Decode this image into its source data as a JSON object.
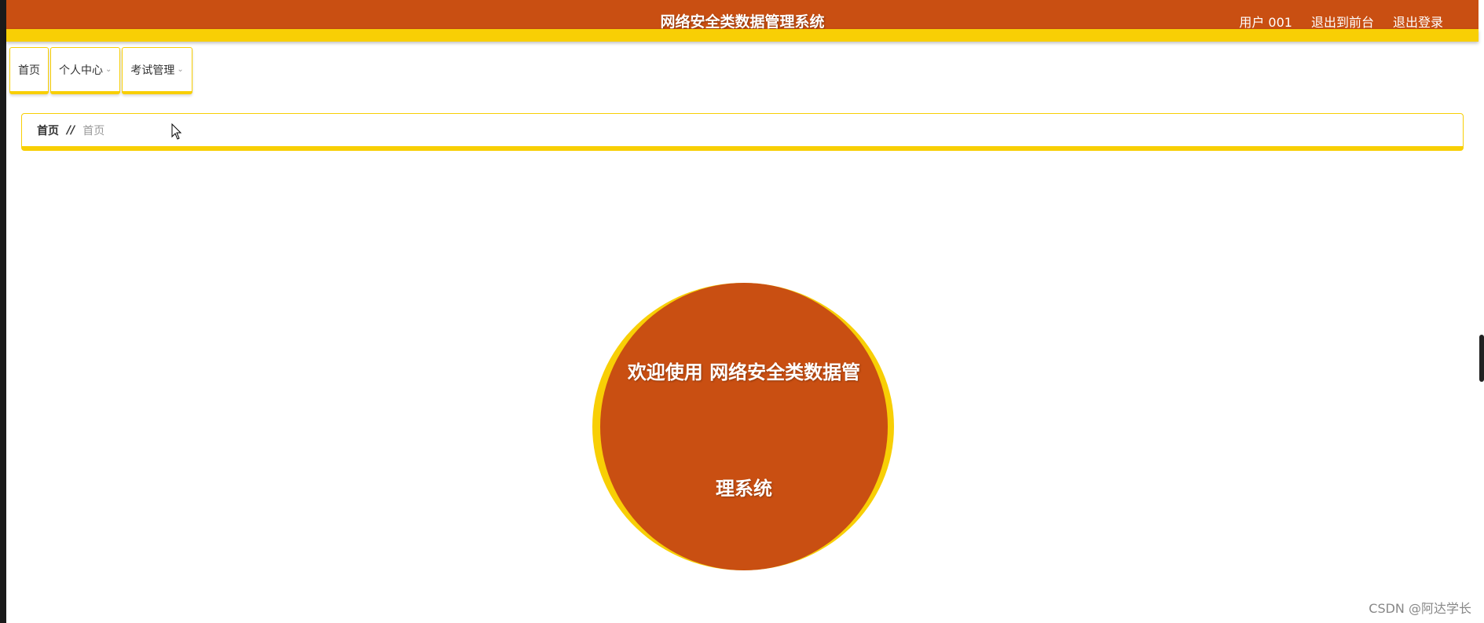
{
  "header": {
    "title": "网络安全类数据管理系统",
    "user_label": "用户 001",
    "exit_front_label": "退出到前台",
    "logout_label": "退出登录"
  },
  "nav": {
    "items": [
      {
        "label": "首页",
        "has_dropdown": false
      },
      {
        "label": "个人中心",
        "has_dropdown": true
      },
      {
        "label": "考试管理",
        "has_dropdown": true
      }
    ]
  },
  "breadcrumb": {
    "home": "首页",
    "separator": "//",
    "current": "首页"
  },
  "welcome": {
    "line1": "欢迎使用 网络安全类数据管",
    "line2": "理系统"
  },
  "watermark": "CSDN @阿达学长",
  "colors": {
    "primary": "#c94f12",
    "accent": "#f8cf05"
  },
  "icons": {
    "dropdown": "chevron-down-icon",
    "cursor": "mouse-pointer-icon"
  }
}
